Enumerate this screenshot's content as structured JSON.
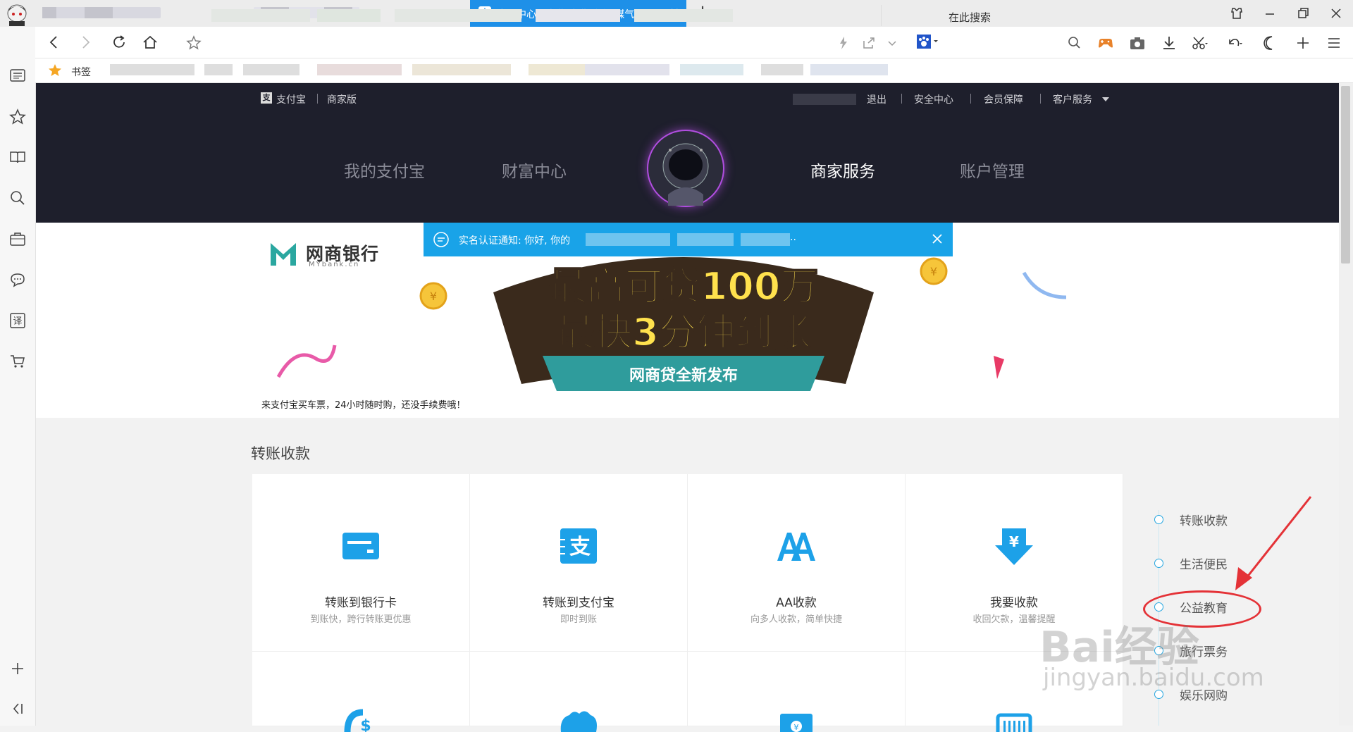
{
  "browser": {
    "active_tab_title": "应用中心 - 电费 水费 燃气 煤气 通讯",
    "active_tab_icon": "支",
    "new_tab_symbol": "+",
    "search_placeholder": "在此搜索",
    "bookmarks_label": "书签",
    "accent": "#1e90e8"
  },
  "alipay": {
    "brand": "支付宝",
    "edition": "商家版",
    "top_links": [
      "退出",
      "安全中心",
      "会员保障",
      "客户服务"
    ],
    "main_nav": [
      "我的支付宝",
      "财富中心",
      "商家服务",
      "账户管理"
    ],
    "active_nav": "商家服务",
    "header_bg": "#1e1f2c"
  },
  "notice": {
    "text": "实名认证通知: 你好, 你的",
    "trailing": ".."
  },
  "banner": {
    "bank_name": "网商银行",
    "bank_domain": "MYbank.cn",
    "headline_1": "最高可贷100万",
    "headline_2": "最快3分钟到账",
    "ribbon": "网商贷全新发布",
    "caption": "来支付宝买车票，24小时随时购，还没手续费哦！"
  },
  "section": {
    "title": "转账收款",
    "cards": [
      {
        "title": "转账到银行卡",
        "sub": "到账快，跨行转账更优惠",
        "icon": "bank-card-icon"
      },
      {
        "title": "转账到支付宝",
        "sub": "即时到账",
        "icon": "alipay-transfer-icon"
      },
      {
        "title": "AA收款",
        "sub": "向多人收款，简单快捷",
        "icon": "aa-icon"
      },
      {
        "title": "我要收款",
        "sub": "收回欠款，温馨提醒",
        "icon": "receive-money-icon"
      }
    ]
  },
  "side_index": [
    "转账收款",
    "生活便民",
    "公益教育",
    "旅行票务",
    "娱乐网购"
  ],
  "watermark": {
    "line1": "Bai经验",
    "line2": "jingyan.baidu.com"
  }
}
